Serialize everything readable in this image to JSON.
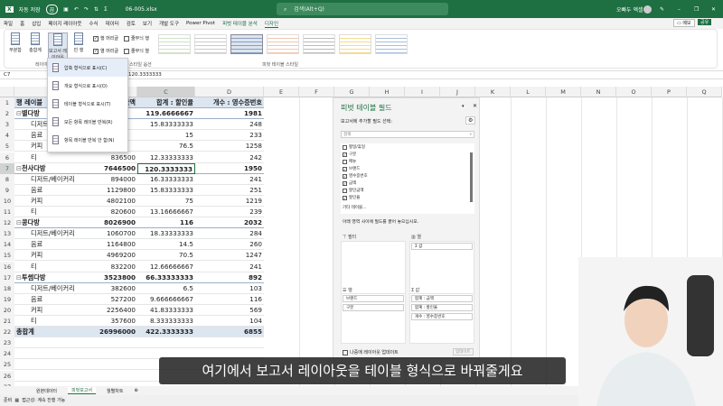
{
  "title": {
    "autosave": "자동 저장",
    "autosave_state": "끔",
    "filename": "06-005.xlsx",
    "search": "검색(Alt+Q)",
    "user": "오빠두 엑셀"
  },
  "tabs": [
    "파일",
    "홈",
    "삽입",
    "페이지 레이아웃",
    "수식",
    "데이터",
    "검토",
    "보기",
    "개발 도구",
    "Power Pivot",
    "피벗 테이블 분석",
    "디자인"
  ],
  "ribbon": {
    "subtotal": "부분합",
    "grandtotal": "총합계",
    "report_layout": "보고서 레이아웃",
    "blank_rows": "빈 행",
    "row_headers": "행 머리글",
    "col_headers": "열 머리글",
    "banded_rows": "줄무늬 행",
    "banded_cols": "줄무늬 열",
    "group_layout": "레이아웃",
    "group_options": "피벗 테이블 스타일 옵션",
    "group_styles": "피벗 테이블 스타일",
    "memo": "메모",
    "share": "공유"
  },
  "formula": {
    "namebox": "C7",
    "value": "120.3333333"
  },
  "menu": [
    "압축 형식으로 표시(C)",
    "개요 형식으로 표시(O)",
    "테이블 형식으로 표시(T)",
    "모든 항목 레이블 반복(R)",
    "항목 레이블 반복 안 함(N)"
  ],
  "columns": [
    "A",
    "B",
    "C",
    "D",
    "E",
    "F",
    "G",
    "H",
    "I",
    "J",
    "K",
    "L",
    "M",
    "N",
    "O",
    "P",
    "Q"
  ],
  "table": {
    "header": [
      "행 레이블",
      "합계 : 금액",
      "합계 : 할인율",
      "개수 : 영수증번호"
    ],
    "rows": [
      {
        "l": "별다방",
        "b": "",
        "c": "119.6666667",
        "d": "1981",
        "g": 1
      },
      {
        "l": "디저트/베이커리",
        "b": "",
        "c": "15.83333333",
        "d": "248"
      },
      {
        "l": "음료",
        "b": "",
        "c": "15",
        "d": "233"
      },
      {
        "l": "커피",
        "b": "",
        "c": "76.5",
        "d": "1258"
      },
      {
        "l": "티",
        "b": "836500",
        "c": "12.33333333",
        "d": "242"
      },
      {
        "l": "천사다방",
        "b": "7646500",
        "c": "120.3333333",
        "d": "1950",
        "g": 1
      },
      {
        "l": "디저트/베이커리",
        "b": "894000",
        "c": "16.33333333",
        "d": "241"
      },
      {
        "l": "음료",
        "b": "1129800",
        "c": "15.83333333",
        "d": "251"
      },
      {
        "l": "커피",
        "b": "4802100",
        "c": "75",
        "d": "1219"
      },
      {
        "l": "티",
        "b": "820600",
        "c": "13.16666667",
        "d": "239"
      },
      {
        "l": "콩다방",
        "b": "8026900",
        "c": "116",
        "d": "2032",
        "g": 1
      },
      {
        "l": "디저트/베이커리",
        "b": "1060700",
        "c": "18.33333333",
        "d": "284"
      },
      {
        "l": "음료",
        "b": "1164800",
        "c": "14.5",
        "d": "260"
      },
      {
        "l": "커피",
        "b": "4969200",
        "c": "70.5",
        "d": "1247"
      },
      {
        "l": "티",
        "b": "832200",
        "c": "12.66666667",
        "d": "241"
      },
      {
        "l": "투썸다방",
        "b": "3523800",
        "c": "66.33333333",
        "d": "892",
        "g": 1
      },
      {
        "l": "디저트/베이커리",
        "b": "382600",
        "c": "6.5",
        "d": "103"
      },
      {
        "l": "음료",
        "b": "527200",
        "c": "9.666666667",
        "d": "116"
      },
      {
        "l": "커피",
        "b": "2256400",
        "c": "41.83333333",
        "d": "569"
      },
      {
        "l": "티",
        "b": "357600",
        "c": "8.333333333",
        "d": "104"
      }
    ],
    "total": {
      "l": "총합계",
      "b": "26996000",
      "c": "422.3333333",
      "d": "6855"
    }
  },
  "pane": {
    "title": "피벗 테이블 필드",
    "choose": "보고서에 추가할 필드 선택:",
    "search": "검색",
    "fields": [
      {
        "n": "평일/휴일",
        "c": false
      },
      {
        "n": "구분",
        "c": true
      },
      {
        "n": "메뉴",
        "c": false
      },
      {
        "n": "브랜드",
        "c": true
      },
      {
        "n": "영수증번호",
        "c": true
      },
      {
        "n": "금액",
        "c": true
      },
      {
        "n": "할인금액",
        "c": false
      },
      {
        "n": "할인율",
        "c": true
      }
    ],
    "more": "기타 테이블...",
    "drag": "아래 영역 사이에 필드를 끌어 놓으십시오.",
    "filter": "필터",
    "columns": "열",
    "rows": "행",
    "values": "값",
    "col_items": [
      "Σ 값"
    ],
    "row_items": [
      "브랜드",
      "구분"
    ],
    "val_items": [
      "합계 : 금액",
      "합계 : 할인율",
      "개수 : 영수증번호"
    ],
    "defer": "나중에 레이아웃 업데이트",
    "update": "업데이트"
  },
  "subtitle": "여기에서 보고서 레이아웃을 테이블 형식으로 바꿔줄게요",
  "sheets": [
    "원본데이터",
    "피벗보고서",
    "월별차트"
  ],
  "status": {
    "ready": "준비",
    "access": "접근성: 계속 진행 가능"
  }
}
